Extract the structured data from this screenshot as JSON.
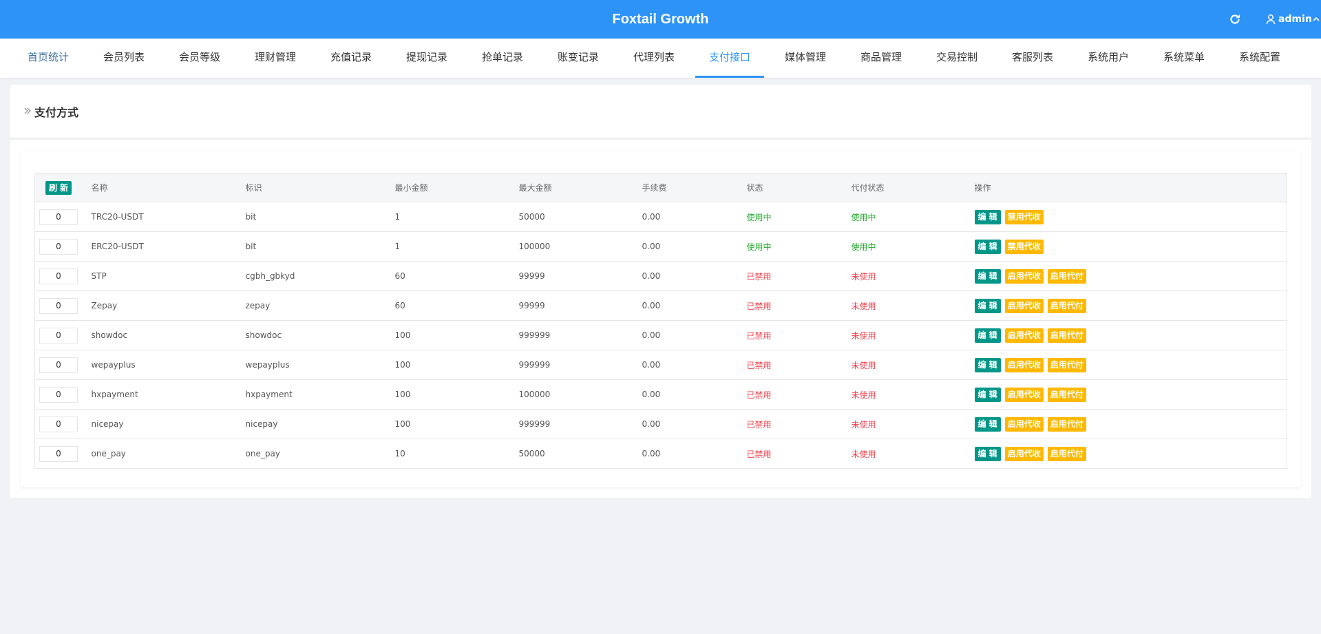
{
  "header": {
    "title": "Foxtail Growth",
    "user": "admin",
    "refresh_icon": "refresh-icon",
    "user_icon": "user-icon"
  },
  "nav": {
    "tabs": [
      {
        "label": "首页统计"
      },
      {
        "label": "会员列表"
      },
      {
        "label": "会员等级"
      },
      {
        "label": "理财管理"
      },
      {
        "label": "充值记录"
      },
      {
        "label": "提现记录"
      },
      {
        "label": "抢单记录"
      },
      {
        "label": "账变记录"
      },
      {
        "label": "代理列表"
      },
      {
        "label": "支付接口"
      },
      {
        "label": "媒体管理"
      },
      {
        "label": "商品管理"
      },
      {
        "label": "交易控制"
      },
      {
        "label": "客服列表"
      },
      {
        "label": "系统用户"
      },
      {
        "label": "系统菜单"
      },
      {
        "label": "系统配置"
      }
    ],
    "active": "支付接口"
  },
  "page": {
    "title": "支付方式"
  },
  "table": {
    "refresh_label": "刷 新",
    "headers": {
      "name": "名称",
      "code": "标识",
      "min": "最小金额",
      "max": "最大金额",
      "fee": "手续费",
      "status": "状态",
      "proxy": "代付状态",
      "ops": "操作"
    },
    "rows": [
      {
        "sort": "0",
        "name": "TRC20-USDT",
        "code": "bit",
        "min": "1",
        "max": "50000",
        "fee": "0.00",
        "status": "使用中",
        "proxy": "使用中",
        "ops": [
          "编 辑",
          "禁用代收"
        ]
      },
      {
        "sort": "0",
        "name": "ERC20-USDT",
        "code": "bit",
        "min": "1",
        "max": "100000",
        "fee": "0.00",
        "status": "使用中",
        "proxy": "使用中",
        "ops": [
          "编 辑",
          "禁用代收"
        ]
      },
      {
        "sort": "0",
        "name": "STP",
        "code": "cgbh_gbkyd",
        "min": "60",
        "max": "99999",
        "fee": "0.00",
        "status": "已禁用",
        "proxy": "未使用",
        "ops": [
          "编 辑",
          "启用代收",
          "启用代付"
        ]
      },
      {
        "sort": "0",
        "name": "Zepay",
        "code": "zepay",
        "min": "60",
        "max": "99999",
        "fee": "0.00",
        "status": "已禁用",
        "proxy": "未使用",
        "ops": [
          "编 辑",
          "启用代收",
          "启用代付"
        ]
      },
      {
        "sort": "0",
        "name": "showdoc",
        "code": "showdoc",
        "min": "100",
        "max": "999999",
        "fee": "0.00",
        "status": "已禁用",
        "proxy": "未使用",
        "ops": [
          "编 辑",
          "启用代收",
          "启用代付"
        ]
      },
      {
        "sort": "0",
        "name": "wepayplus",
        "code": "wepayplus",
        "min": "100",
        "max": "999999",
        "fee": "0.00",
        "status": "已禁用",
        "proxy": "未使用",
        "ops": [
          "编 辑",
          "启用代收",
          "启用代付"
        ]
      },
      {
        "sort": "0",
        "name": "hxpayment",
        "code": "hxpayment",
        "min": "100",
        "max": "100000",
        "fee": "0.00",
        "status": "已禁用",
        "proxy": "未使用",
        "ops": [
          "编 辑",
          "启用代收",
          "启用代付"
        ]
      },
      {
        "sort": "0",
        "name": "nicepay",
        "code": "nicepay",
        "min": "100",
        "max": "999999",
        "fee": "0.00",
        "status": "已禁用",
        "proxy": "未使用",
        "ops": [
          "编 辑",
          "启用代收",
          "启用代付"
        ]
      },
      {
        "sort": "0",
        "name": "one_pay",
        "code": "one_pay",
        "min": "10",
        "max": "50000",
        "fee": "0.00",
        "status": "已禁用",
        "proxy": "未使用",
        "ops": [
          "编 辑",
          "启用代收",
          "启用代付"
        ]
      }
    ]
  },
  "colors": {
    "header_bg": "#2d93f7",
    "active_tab": "#2d93f7",
    "status_on": "#22a82b",
    "status_off": "#f0414d",
    "btn_edit": "#009688",
    "btn_warn": "#ffb800"
  }
}
